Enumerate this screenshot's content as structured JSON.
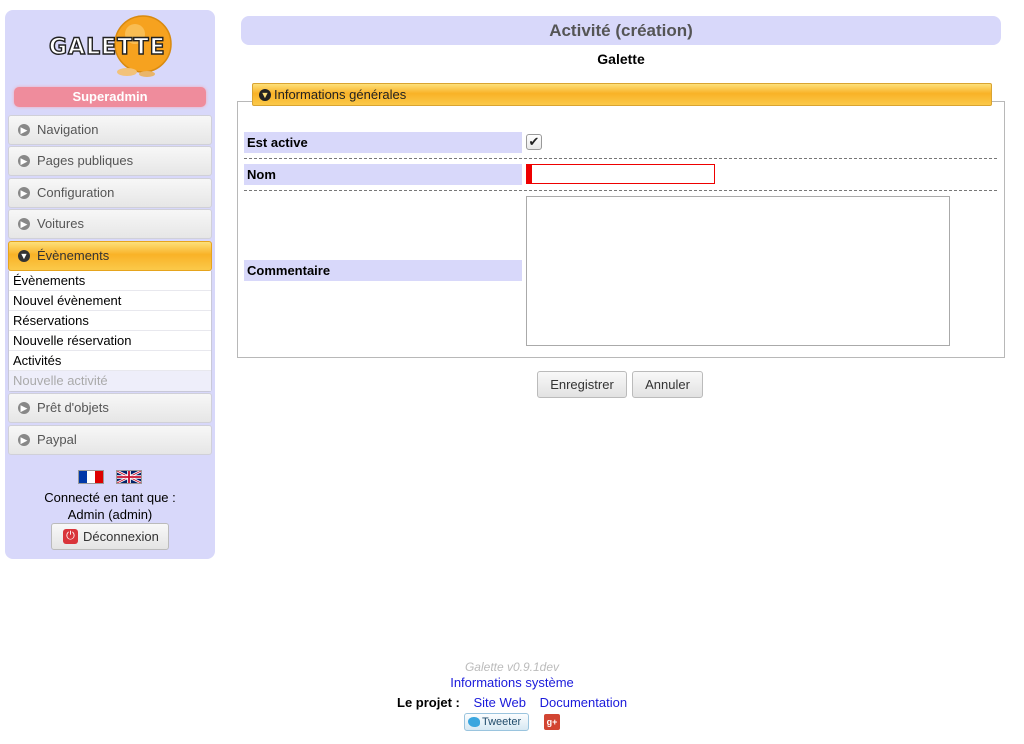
{
  "sidebar": {
    "logo_text": "GALETTE",
    "role": "Superadmin",
    "menu": [
      {
        "label": "Navigation"
      },
      {
        "label": "Pages publiques"
      },
      {
        "label": "Configuration"
      },
      {
        "label": "Voitures"
      },
      {
        "label": "Évènements",
        "active": true
      },
      {
        "label": "Prêt d'objets"
      },
      {
        "label": "Paypal"
      }
    ],
    "submenu": [
      {
        "label": "Évènements"
      },
      {
        "label": "Nouvel évènement"
      },
      {
        "label": "Réservations"
      },
      {
        "label": "Nouvelle réservation"
      },
      {
        "label": "Activités"
      },
      {
        "label": "Nouvelle activité",
        "current": true
      }
    ],
    "languages": [
      "fr",
      "en"
    ],
    "logged_label": "Connecté en tant que :",
    "logged_user": "Admin (admin)",
    "logout_label": "Déconnexion"
  },
  "main": {
    "title": "Activité (création)",
    "org_name": "Galette",
    "section_title": "Informations générales",
    "fields": {
      "active_label": "Est active",
      "active_checked": true,
      "name_label": "Nom",
      "name_value": "",
      "comment_label": "Commentaire",
      "comment_value": ""
    },
    "save_label": "Enregistrer",
    "cancel_label": "Annuler"
  },
  "footer": {
    "version": "Galette v0.9.1dev",
    "sysinfo": "Informations système",
    "project_label": "Le projet :",
    "website": "Site Web",
    "documentation": "Documentation",
    "tweet_label": "Tweeter",
    "gplus_label": "g+"
  },
  "colors": {
    "panel": "#d8d8fa",
    "accent": "#f9b227",
    "role_badge": "#ef8c9c",
    "required": "#ee0000",
    "link": "#1a1adb"
  }
}
